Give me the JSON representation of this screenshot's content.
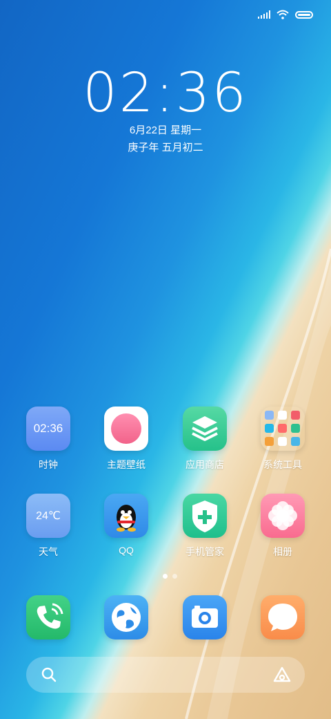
{
  "clock": {
    "time": "02:36",
    "date": "6月22日 星期一",
    "lunar": "庚子年 五月初二"
  },
  "apps_row1": [
    {
      "label": "时钟",
      "icon": "clock-icon",
      "text": "02:36"
    },
    {
      "label": "主题壁纸",
      "icon": "theme-wallpaper-icon"
    },
    {
      "label": "应用商店",
      "icon": "app-store-icon"
    },
    {
      "label": "系统工具",
      "icon": "system-tools-folder-icon"
    }
  ],
  "apps_row2": [
    {
      "label": "天气",
      "icon": "weather-icon",
      "text": "24℃"
    },
    {
      "label": "QQ",
      "icon": "qq-icon"
    },
    {
      "label": "手机管家",
      "icon": "security-icon"
    },
    {
      "label": "相册",
      "icon": "gallery-icon"
    }
  ],
  "dock": [
    {
      "icon": "phone-icon"
    },
    {
      "icon": "browser-icon"
    },
    {
      "icon": "camera-icon"
    },
    {
      "icon": "messages-icon"
    }
  ],
  "pager": {
    "pages": 2,
    "current": 1
  },
  "colors": {
    "sea": "#1577d6",
    "sand": "#e8c694",
    "accent_green": "#25c18a"
  }
}
